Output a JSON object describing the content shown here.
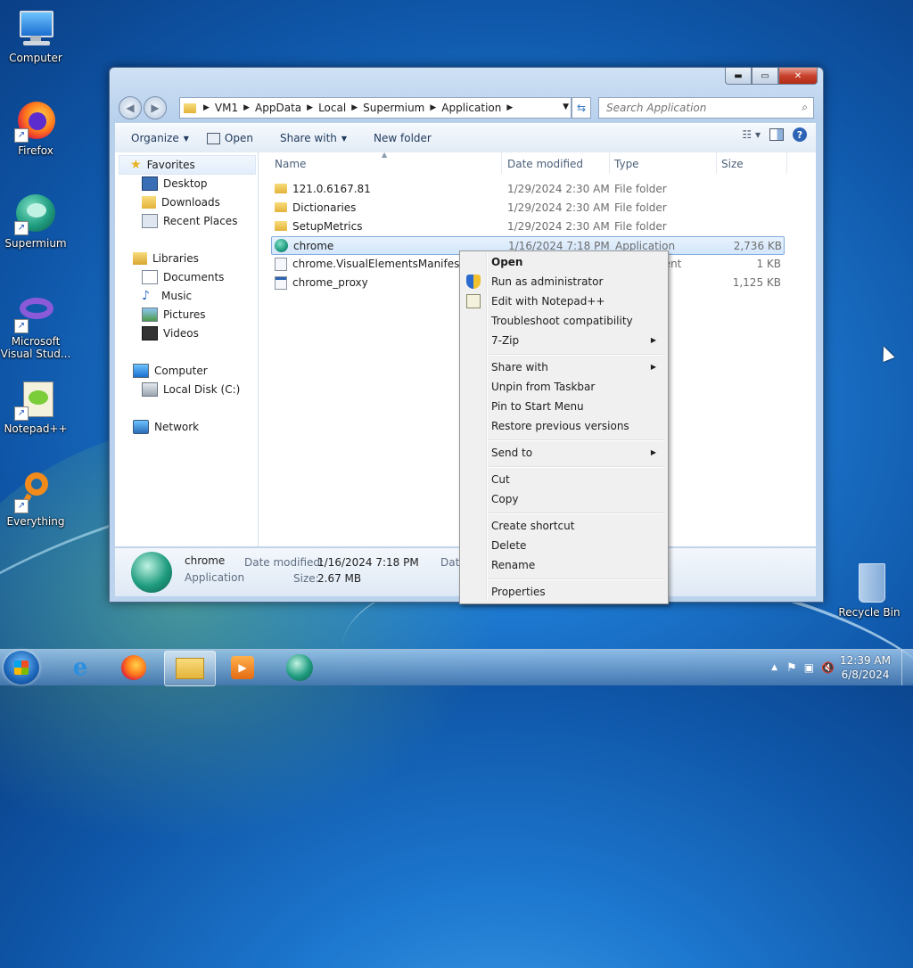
{
  "desktop": {
    "icons": [
      {
        "label": "Computer",
        "icon": "computer-icon"
      },
      {
        "label": "Firefox",
        "icon": "firefox-icon"
      },
      {
        "label": "Supermium",
        "icon": "supermium-icon"
      },
      {
        "label": "Microsoft Visual Stud...",
        "icon": "visual-studio-icon"
      },
      {
        "label": "Notepad++",
        "icon": "notepadpp-icon"
      },
      {
        "label": "Everything",
        "icon": "everything-icon"
      },
      {
        "label": "Recycle Bin",
        "icon": "recycle-bin-icon"
      }
    ]
  },
  "explorer": {
    "breadcrumb": [
      "VM1",
      "AppData",
      "Local",
      "Supermium",
      "Application"
    ],
    "search_placeholder": "Search Application",
    "toolbar": {
      "organize": "Organize",
      "open": "Open",
      "share_with": "Share with",
      "new_folder": "New folder"
    },
    "nav": {
      "favorites": "Favorites",
      "desktop": "Desktop",
      "downloads": "Downloads",
      "recent_places": "Recent Places",
      "libraries": "Libraries",
      "documents": "Documents",
      "music": "Music",
      "pictures": "Pictures",
      "videos": "Videos",
      "computer": "Computer",
      "local_disk": "Local Disk (C:)",
      "network": "Network"
    },
    "columns": {
      "name": "Name",
      "date_modified": "Date modified",
      "type": "Type",
      "size": "Size"
    },
    "files": [
      {
        "name": "121.0.6167.81",
        "date": "1/29/2024 2:30 AM",
        "type": "File folder",
        "size": ""
      },
      {
        "name": "Dictionaries",
        "date": "1/29/2024 2:30 AM",
        "type": "File folder",
        "size": ""
      },
      {
        "name": "SetupMetrics",
        "date": "1/29/2024 2:30 AM",
        "type": "File folder",
        "size": ""
      },
      {
        "name": "chrome",
        "date": "1/16/2024 7:18 PM",
        "type": "Application",
        "size": "2,736 KB"
      },
      {
        "name": "chrome.VisualElementsManifest",
        "date": "",
        "type": "ment",
        "size": "1 KB"
      },
      {
        "name": "chrome_proxy",
        "date": "",
        "type": "",
        "size": "1,125 KB"
      }
    ],
    "details": {
      "name": "chrome",
      "type": "Application",
      "date_label": "Date modified:",
      "date_value": "1/16/2024 7:18 PM",
      "size_label": "Size:",
      "size_value": "2.67 MB",
      "date_created_cut": "Date"
    }
  },
  "context_menu": {
    "open": "Open",
    "run_as_admin": "Run as administrator",
    "edit_notepad": "Edit with Notepad++",
    "troubleshoot": "Troubleshoot compatibility",
    "seven_zip": "7-Zip",
    "share_with": "Share with",
    "unpin_taskbar": "Unpin from Taskbar",
    "pin_start": "Pin to Start Menu",
    "restore_versions": "Restore previous versions",
    "send_to": "Send to",
    "cut": "Cut",
    "copy": "Copy",
    "create_shortcut": "Create shortcut",
    "delete": "Delete",
    "rename": "Rename",
    "properties": "Properties"
  },
  "taskbar": {
    "time": "12:39 AM",
    "date": "6/8/2024"
  }
}
